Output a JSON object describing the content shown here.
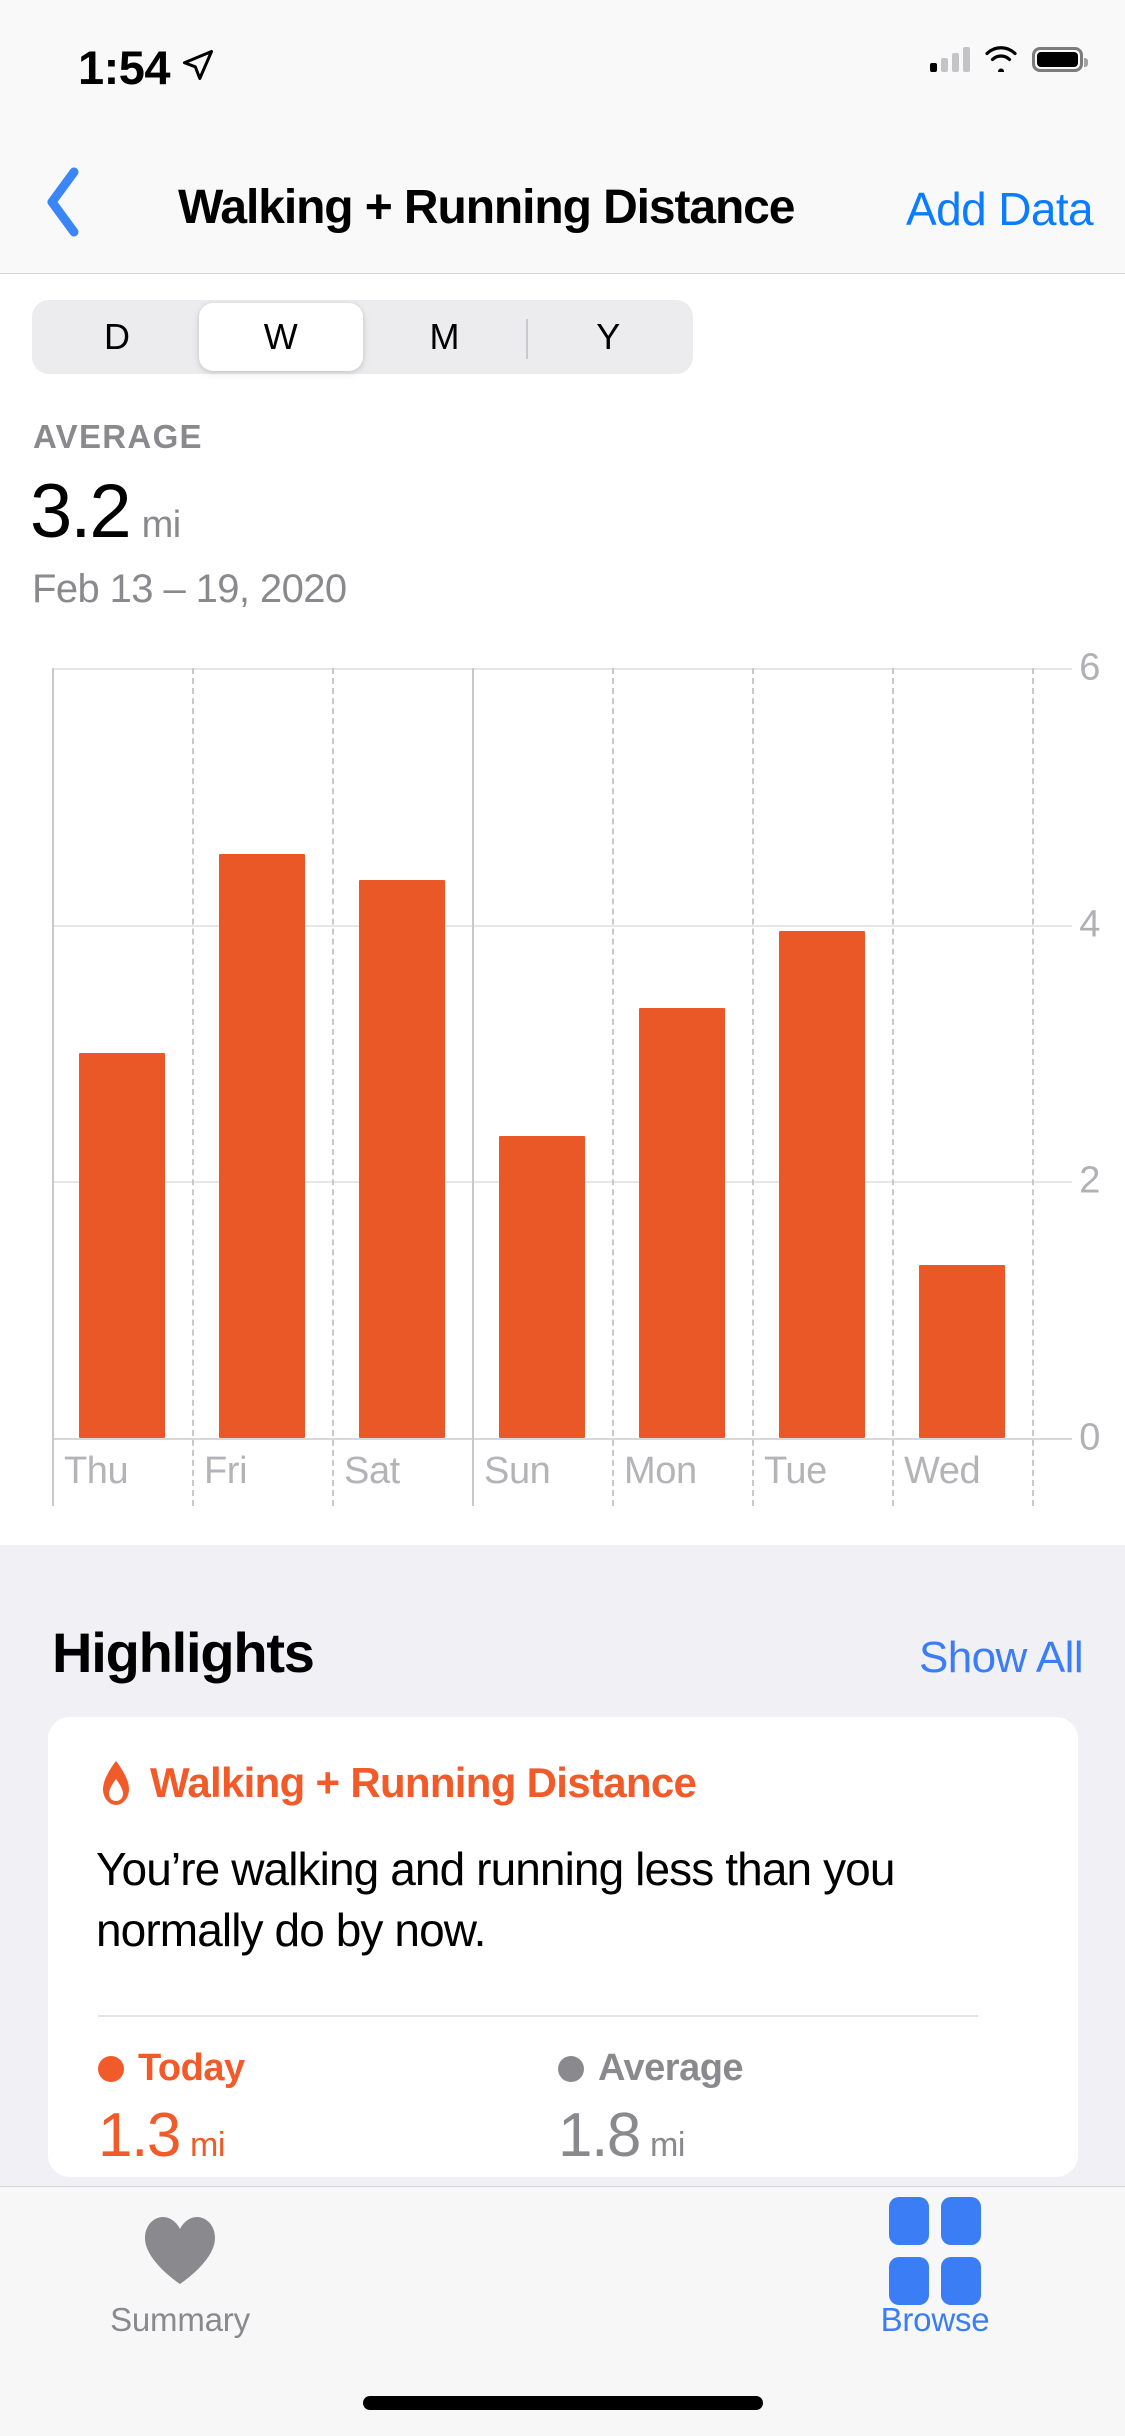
{
  "status_bar": {
    "time": "1:54",
    "location_icon": "location-arrow-icon",
    "cellular_icon": "cellular-signal-icon",
    "wifi_icon": "wifi-icon",
    "battery_icon": "battery-icon"
  },
  "nav": {
    "back_icon": "chevron-left-icon",
    "title": "Walking + Running Distance",
    "action_label": "Add Data"
  },
  "segmented": {
    "options": [
      "D",
      "W",
      "M",
      "Y"
    ],
    "selected": "W"
  },
  "average": {
    "label": "AVERAGE",
    "value": "3.2",
    "unit": "mi",
    "date_range": "Feb 13 – 19, 2020"
  },
  "chart_data": {
    "type": "bar",
    "title": "",
    "xlabel": "",
    "ylabel": "",
    "categories": [
      "Thu",
      "Fri",
      "Sat",
      "Sun",
      "Mon",
      "Tue",
      "Wed"
    ],
    "values": [
      3.0,
      4.55,
      4.35,
      2.35,
      3.35,
      3.95,
      1.35
    ],
    "ylim": [
      0,
      6
    ],
    "yticks": [
      0,
      2,
      4,
      6
    ],
    "ytick_labels": [
      "0",
      "2",
      "4",
      "6"
    ],
    "grid": true,
    "bar_color": "#ea5827",
    "gridline_color": "#e6e6e8",
    "separator_color": "#c9c9cd",
    "week_boundary_after": "Sat",
    "legend": ""
  },
  "highlights": {
    "title": "Highlights",
    "show_all_label": "Show All",
    "card": {
      "icon": "flame-icon",
      "category": "Walking + Running Distance",
      "message": "You’re walking and running less than you normally do by now.",
      "stats": [
        {
          "name": "Today",
          "value": "1.3",
          "unit": "mi",
          "color": "#f15a29",
          "dot_icon": "orange-dot-icon"
        },
        {
          "name": "Average",
          "value": "1.8",
          "unit": "mi",
          "color": "#8a8a8e",
          "dot_icon": "gray-dot-icon"
        }
      ]
    }
  },
  "tab_bar": {
    "tabs": [
      {
        "label": "Summary",
        "icon": "heart-icon",
        "active": false
      },
      {
        "label": "Browse",
        "icon": "grid-icon",
        "active": true
      }
    ]
  },
  "colors": {
    "accent_blue": "#0a7cff",
    "link_blue": "#3b7df5",
    "orange": "#ea5827",
    "card_orange": "#f15a29",
    "gray_text": "#8a8a8e",
    "group_bg": "#f1f1f5"
  }
}
